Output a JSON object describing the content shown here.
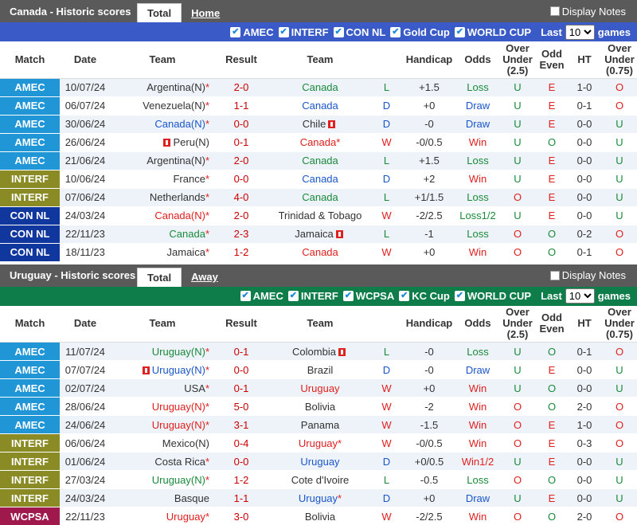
{
  "colors": {
    "AMEC": "#2196d6",
    "INTERF": "#8b8b25",
    "CONNL": "#10379e",
    "WCPSA": "#a0194c"
  },
  "headers": [
    "Match",
    "Date",
    "Team",
    "Result",
    "Team",
    "",
    "Handicap",
    "Odds",
    "Over Under (2.5)",
    "Odd Even",
    "HT",
    "Over Under (0.75)"
  ],
  "canada": {
    "title": "Canada - Historic scores",
    "tab_total": "Total",
    "tab_other": "Home",
    "display_notes": "Display Notes",
    "filters": [
      "AMEC",
      "INTERF",
      "CON NL",
      "Gold Cup",
      "WORLD CUP"
    ],
    "last_label": "Last",
    "last_value": "10",
    "games_label": "games",
    "rows": [
      {
        "comp": "AMEC",
        "date": "10/07/24",
        "home": "Argentina(N)",
        "hm": "*",
        "hflag": false,
        "hc": "plain",
        "score": "2-0",
        "away": "Canada",
        "am": "",
        "aflag": false,
        "ac": "hl-green",
        "res": "L",
        "hcap": "+1.5",
        "odds": "Loss",
        "ou": "U",
        "oe": "E",
        "ht": "1-0",
        "ou2": "O"
      },
      {
        "comp": "AMEC",
        "date": "06/07/24",
        "home": "Venezuela(N)",
        "hm": "*",
        "hflag": false,
        "hc": "plain",
        "score": "1-1",
        "away": "Canada",
        "am": "",
        "aflag": false,
        "ac": "hl-blue",
        "res": "D",
        "hcap": "+0",
        "odds": "Draw",
        "ou": "U",
        "oe": "E",
        "ht": "0-1",
        "ou2": "O"
      },
      {
        "comp": "AMEC",
        "date": "30/06/24",
        "home": "Canada(N)",
        "hm": "*",
        "hflag": false,
        "hc": "hl-blue",
        "score": "0-0",
        "away": "Chile",
        "am": "",
        "aflag": true,
        "ac": "plain",
        "res": "D",
        "hcap": "-0",
        "odds": "Draw",
        "ou": "U",
        "oe": "E",
        "ht": "0-0",
        "ou2": "U"
      },
      {
        "comp": "AMEC",
        "date": "26/06/24",
        "home": "Peru(N)",
        "hm": "",
        "hflag": true,
        "hc": "plain",
        "score": "0-1",
        "away": "Canada",
        "am": "*",
        "aflag": false,
        "ac": "hl-red",
        "res": "W",
        "hcap": "-0/0.5",
        "odds": "Win",
        "ou": "U",
        "oe": "O",
        "ht": "0-0",
        "ou2": "U"
      },
      {
        "comp": "AMEC",
        "date": "21/06/24",
        "home": "Argentina(N)",
        "hm": "*",
        "hflag": false,
        "hc": "plain",
        "score": "2-0",
        "away": "Canada",
        "am": "",
        "aflag": false,
        "ac": "hl-green",
        "res": "L",
        "hcap": "+1.5",
        "odds": "Loss",
        "ou": "U",
        "oe": "E",
        "ht": "0-0",
        "ou2": "U"
      },
      {
        "comp": "INTERF",
        "date": "10/06/24",
        "home": "France",
        "hm": "*",
        "hflag": false,
        "hc": "plain",
        "score": "0-0",
        "away": "Canada",
        "am": "",
        "aflag": false,
        "ac": "hl-blue",
        "res": "D",
        "hcap": "+2",
        "odds": "Win",
        "ou": "U",
        "oe": "E",
        "ht": "0-0",
        "ou2": "U"
      },
      {
        "comp": "INTERF",
        "date": "07/06/24",
        "home": "Netherlands",
        "hm": "*",
        "hflag": false,
        "hc": "plain",
        "score": "4-0",
        "away": "Canada",
        "am": "",
        "aflag": false,
        "ac": "hl-green",
        "res": "L",
        "hcap": "+1/1.5",
        "odds": "Loss",
        "ou": "O",
        "oe": "E",
        "ht": "0-0",
        "ou2": "U"
      },
      {
        "comp": "CON NL",
        "date": "24/03/24",
        "home": "Canada(N)",
        "hm": "*",
        "hflag": false,
        "hc": "hl-red",
        "score": "2-0",
        "away": "Trinidad & Tobago",
        "am": "",
        "aflag": false,
        "ac": "plain",
        "res": "W",
        "hcap": "-2/2.5",
        "odds": "Loss1/2",
        "ou": "U",
        "oe": "E",
        "ht": "0-0",
        "ou2": "U"
      },
      {
        "comp": "CON NL",
        "date": "22/11/23",
        "home": "Canada",
        "hm": "*",
        "hflag": false,
        "hc": "hl-green",
        "score": "2-3",
        "away": "Jamaica",
        "am": "",
        "aflag": true,
        "ac": "plain",
        "res": "L",
        "hcap": "-1",
        "odds": "Loss",
        "ou": "O",
        "oe": "O",
        "ht": "0-2",
        "ou2": "O"
      },
      {
        "comp": "CON NL",
        "date": "18/11/23",
        "home": "Jamaica",
        "hm": "*",
        "hflag": false,
        "hc": "plain",
        "score": "1-2",
        "away": "Canada",
        "am": "",
        "aflag": false,
        "ac": "hl-red",
        "res": "W",
        "hcap": "+0",
        "odds": "Win",
        "ou": "O",
        "oe": "O",
        "ht": "0-1",
        "ou2": "O"
      }
    ]
  },
  "uruguay": {
    "title": "Uruguay - Historic scores",
    "tab_total": "Total",
    "tab_other": "Away",
    "display_notes": "Display Notes",
    "filters": [
      "AMEC",
      "INTERF",
      "WCPSA",
      "KC Cup",
      "WORLD CUP"
    ],
    "last_label": "Last",
    "last_value": "10",
    "games_label": "games",
    "rows": [
      {
        "comp": "AMEC",
        "date": "11/07/24",
        "home": "Uruguay(N)",
        "hm": "*",
        "hflag": false,
        "hc": "hl-green",
        "score": "0-1",
        "away": "Colombia",
        "am": "",
        "aflag": true,
        "ac": "plain",
        "res": "L",
        "hcap": "-0",
        "odds": "Loss",
        "ou": "U",
        "oe": "O",
        "ht": "0-1",
        "ou2": "O"
      },
      {
        "comp": "AMEC",
        "date": "07/07/24",
        "home": "Uruguay(N)",
        "hm": "*",
        "hflag": true,
        "hc": "hl-blue",
        "score": "0-0",
        "away": "Brazil",
        "am": "",
        "aflag": false,
        "ac": "plain",
        "res": "D",
        "hcap": "-0",
        "odds": "Draw",
        "ou": "U",
        "oe": "E",
        "ht": "0-0",
        "ou2": "U"
      },
      {
        "comp": "AMEC",
        "date": "02/07/24",
        "home": "USA",
        "hm": "*",
        "hflag": false,
        "hc": "plain",
        "score": "0-1",
        "away": "Uruguay",
        "am": "",
        "aflag": false,
        "ac": "hl-red",
        "res": "W",
        "hcap": "+0",
        "odds": "Win",
        "ou": "U",
        "oe": "O",
        "ht": "0-0",
        "ou2": "U"
      },
      {
        "comp": "AMEC",
        "date": "28/06/24",
        "home": "Uruguay(N)",
        "hm": "*",
        "hflag": false,
        "hc": "hl-red",
        "score": "5-0",
        "away": "Bolivia",
        "am": "",
        "aflag": false,
        "ac": "plain",
        "res": "W",
        "hcap": "-2",
        "odds": "Win",
        "ou": "O",
        "oe": "O",
        "ht": "2-0",
        "ou2": "O"
      },
      {
        "comp": "AMEC",
        "date": "24/06/24",
        "home": "Uruguay(N)",
        "hm": "*",
        "hflag": false,
        "hc": "hl-red",
        "score": "3-1",
        "away": "Panama",
        "am": "",
        "aflag": false,
        "ac": "plain",
        "res": "W",
        "hcap": "-1.5",
        "odds": "Win",
        "ou": "O",
        "oe": "E",
        "ht": "1-0",
        "ou2": "O"
      },
      {
        "comp": "INTERF",
        "date": "06/06/24",
        "home": "Mexico(N)",
        "hm": "",
        "hflag": false,
        "hc": "plain",
        "score": "0-4",
        "away": "Uruguay",
        "am": "*",
        "aflag": false,
        "ac": "hl-red",
        "res": "W",
        "hcap": "-0/0.5",
        "odds": "Win",
        "ou": "O",
        "oe": "E",
        "ht": "0-3",
        "ou2": "O"
      },
      {
        "comp": "INTERF",
        "date": "01/06/24",
        "home": "Costa Rica",
        "hm": "*",
        "hflag": false,
        "hc": "plain",
        "score": "0-0",
        "away": "Uruguay",
        "am": "",
        "aflag": false,
        "ac": "hl-blue",
        "res": "D",
        "hcap": "+0/0.5",
        "odds": "Win1/2",
        "ou": "U",
        "oe": "E",
        "ht": "0-0",
        "ou2": "U"
      },
      {
        "comp": "INTERF",
        "date": "27/03/24",
        "home": "Uruguay(N)",
        "hm": "*",
        "hflag": false,
        "hc": "hl-green",
        "score": "1-2",
        "away": "Cote d'Ivoire",
        "am": "",
        "aflag": false,
        "ac": "plain",
        "res": "L",
        "hcap": "-0.5",
        "odds": "Loss",
        "ou": "O",
        "oe": "O",
        "ht": "0-0",
        "ou2": "U"
      },
      {
        "comp": "INTERF",
        "date": "24/03/24",
        "home": "Basque",
        "hm": "",
        "hflag": false,
        "hc": "plain",
        "score": "1-1",
        "away": "Uruguay",
        "am": "*",
        "aflag": false,
        "ac": "hl-blue",
        "res": "D",
        "hcap": "+0",
        "odds": "Draw",
        "ou": "U",
        "oe": "E",
        "ht": "0-0",
        "ou2": "U"
      },
      {
        "comp": "WCPSA",
        "date": "22/11/23",
        "home": "Uruguay",
        "hm": "*",
        "hflag": false,
        "hc": "hl-red",
        "score": "3-0",
        "away": "Bolivia",
        "am": "",
        "aflag": false,
        "ac": "plain",
        "res": "W",
        "hcap": "-2/2.5",
        "odds": "Win",
        "ou": "O",
        "oe": "O",
        "ht": "2-0",
        "ou2": "O"
      }
    ]
  }
}
